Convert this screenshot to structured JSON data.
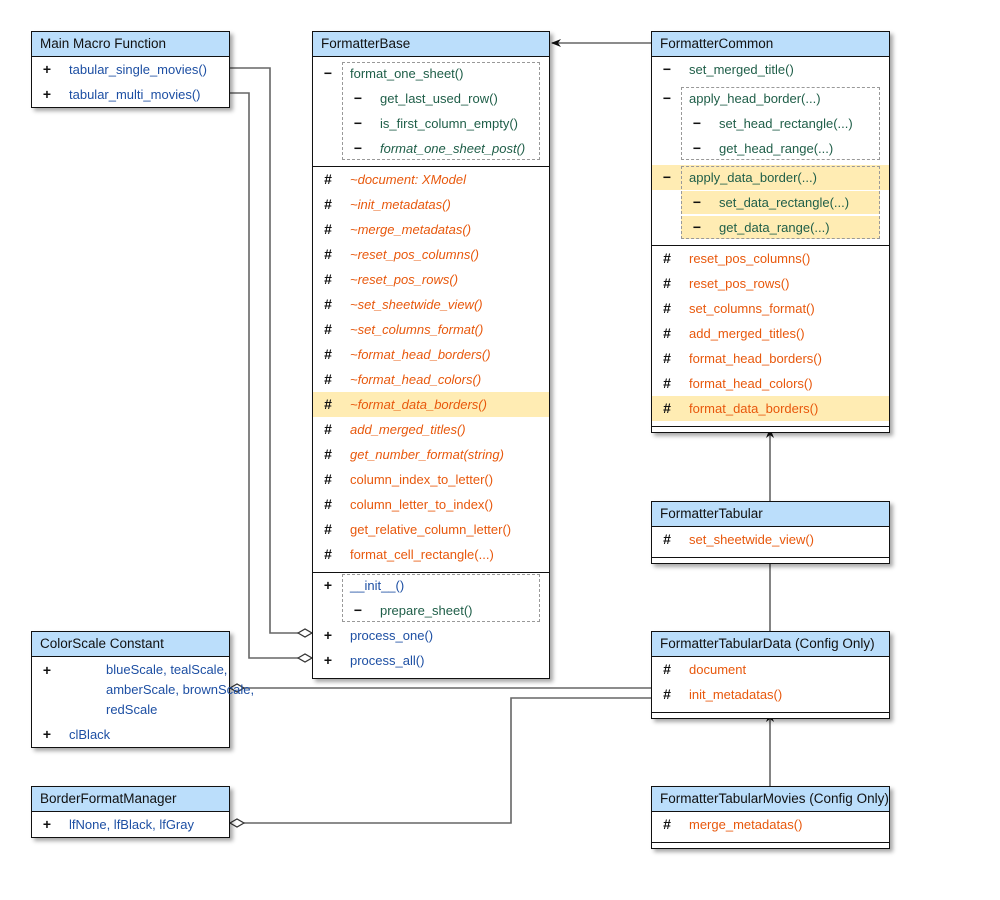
{
  "classes": [
    {
      "id": "main",
      "title": "Main Macro Function",
      "sections": [
        [
          {
            "visibility": "+",
            "text": "tabular_single_movies()",
            "kind": "pub"
          },
          {
            "visibility": "+",
            "text": "tabular_multi_movies()",
            "kind": "pub"
          }
        ]
      ]
    },
    {
      "id": "base",
      "title": "FormatterBase",
      "sections": [
        [
          {
            "group": [
              {
                "visibility": "−",
                "text": "format_one_sheet()",
                "kind": "pri"
              },
              {
                "visibility": "−",
                "text": "get_last_used_row()",
                "kind": "pri",
                "nested": true
              },
              {
                "visibility": "−",
                "text": "is_first_column_empty()",
                "kind": "pri",
                "nested": true
              },
              {
                "visibility": "−",
                "text": "format_one_sheet_post()",
                "kind": "pri",
                "nested": true,
                "italic": true
              }
            ]
          }
        ],
        [
          {
            "visibility": "#",
            "text": "~document: XModel",
            "kind": "pro",
            "italic": true
          },
          {
            "visibility": "#",
            "text": "~init_metadatas()",
            "kind": "pro",
            "italic": true
          },
          {
            "visibility": "#",
            "text": "~merge_metadatas()",
            "kind": "pro",
            "italic": true
          },
          {
            "visibility": "#",
            "text": "~reset_pos_columns()",
            "kind": "pro",
            "italic": true
          },
          {
            "visibility": "#",
            "text": "~reset_pos_rows()",
            "kind": "pro",
            "italic": true
          },
          {
            "visibility": "#",
            "text": "~set_sheetwide_view()",
            "kind": "pro",
            "italic": true
          },
          {
            "visibility": "#",
            "text": "~set_columns_format()",
            "kind": "pro",
            "italic": true
          },
          {
            "visibility": "#",
            "text": "~format_head_borders()",
            "kind": "pro",
            "italic": true
          },
          {
            "visibility": "#",
            "text": "~format_head_colors()",
            "kind": "pro",
            "italic": true
          },
          {
            "visibility": "#",
            "text": "~format_data_borders()",
            "kind": "pro",
            "italic": true,
            "highlight": "full"
          },
          {
            "visibility": "#",
            "text": "add_merged_titles()",
            "kind": "pro",
            "italic": true
          },
          {
            "visibility": "#",
            "text": "get_number_format(string)",
            "kind": "pro",
            "italic": true
          },
          {
            "visibility": "#",
            "text": "column_index_to_letter()",
            "kind": "pro"
          },
          {
            "visibility": "#",
            "text": "column_letter_to_index()",
            "kind": "pro"
          },
          {
            "visibility": "#",
            "text": "get_relative_column_letter()",
            "kind": "pro"
          },
          {
            "visibility": "#",
            "text": "format_cell_rectangle(...)",
            "kind": "pro"
          }
        ],
        [
          {
            "group": [
              {
                "visibility": "+",
                "text": "__init__()",
                "kind": "pub"
              },
              {
                "visibility": "−",
                "text": "prepare_sheet()",
                "kind": "pri",
                "nested": true
              }
            ]
          },
          {
            "visibility": "+",
            "text": "process_one()",
            "kind": "pub"
          },
          {
            "visibility": "+",
            "text": "process_all()",
            "kind": "pub"
          }
        ]
      ]
    },
    {
      "id": "common",
      "title": "FormatterCommon",
      "sections": [
        [
          {
            "visibility": "−",
            "text": "set_merged_title()",
            "kind": "pri"
          },
          {
            "group": [
              {
                "visibility": "−",
                "text": "apply_head_border(...)",
                "kind": "pri"
              },
              {
                "visibility": "−",
                "text": "set_head_rectangle(...)",
                "kind": "pri",
                "nested": true
              },
              {
                "visibility": "−",
                "text": "get_head_range(...)",
                "kind": "pri",
                "nested": true
              }
            ]
          },
          {
            "group": [
              {
                "visibility": "−",
                "text": "apply_data_border(...)",
                "kind": "pri",
                "highlight": "full"
              },
              {
                "visibility": "−",
                "text": "set_data_rectangle(...)",
                "kind": "pri",
                "nested": true,
                "highlight": "inner"
              },
              {
                "visibility": "−",
                "text": "get_data_range(...)",
                "kind": "pri",
                "nested": true,
                "highlight": "inner"
              }
            ]
          }
        ],
        [
          {
            "visibility": "#",
            "text": "reset_pos_columns()",
            "kind": "pro"
          },
          {
            "visibility": "#",
            "text": "reset_pos_rows()",
            "kind": "pro"
          },
          {
            "visibility": "#",
            "text": "set_columns_format()",
            "kind": "pro"
          },
          {
            "visibility": "#",
            "text": "add_merged_titles()",
            "kind": "pro"
          },
          {
            "visibility": "#",
            "text": "format_head_borders()",
            "kind": "pro"
          },
          {
            "visibility": "#",
            "text": "format_head_colors()",
            "kind": "pro"
          },
          {
            "visibility": "#",
            "text": "format_data_borders()",
            "kind": "pro",
            "highlight": "full"
          }
        ],
        []
      ]
    },
    {
      "id": "tabular",
      "title": "FormatterTabular",
      "sections": [
        [
          {
            "visibility": "#",
            "text": "set_sheetwide_view()",
            "kind": "pro"
          }
        ],
        []
      ]
    },
    {
      "id": "tabdata",
      "title": "FormatterTabularData (Config Only)",
      "sections": [
        [
          {
            "visibility": "#",
            "text": "document",
            "kind": "pro"
          },
          {
            "visibility": "#",
            "text": "init_metadatas()",
            "kind": "pro"
          }
        ],
        []
      ]
    },
    {
      "id": "movies",
      "title": "FormatterTabularMovies (Config Only)",
      "sections": [
        [
          {
            "visibility": "#",
            "text": "merge_metadatas()",
            "kind": "pro"
          }
        ],
        []
      ]
    },
    {
      "id": "color",
      "title": "ColorScale Constant",
      "sections": [
        [
          {
            "visibility": "+",
            "text": "blueScale, tealScale,\namberScale, brownScale,\nredScale",
            "kind": "pub",
            "multi": true
          },
          {
            "visibility": "+",
            "text": "clBlack",
            "kind": "pub"
          }
        ]
      ]
    },
    {
      "id": "border",
      "title": "BorderFormatManager",
      "sections": [
        [
          {
            "visibility": "+",
            "text": "lfNone, lfBlack, lfGray",
            "kind": "pub"
          }
        ]
      ]
    }
  ],
  "relations": [
    {
      "type": "inheritance",
      "from": "FormatterCommon",
      "to": "FormatterBase"
    },
    {
      "type": "inheritance",
      "from": "FormatterTabular",
      "to": "FormatterCommon"
    },
    {
      "type": "inheritance",
      "from": "FormatterTabularData (Config Only)",
      "to": "FormatterTabular"
    },
    {
      "type": "inheritance",
      "from": "FormatterTabularMovies (Config Only)",
      "to": "FormatterTabularData (Config Only)"
    },
    {
      "type": "aggregation",
      "from": "tabular_single_movies()",
      "to": "process_one()"
    },
    {
      "type": "aggregation",
      "from": "tabular_multi_movies()",
      "to": "process_all()"
    },
    {
      "type": "aggregation",
      "from": "FormatterTabularData (Config Only)",
      "to": "ColorScale Constant"
    },
    {
      "type": "aggregation",
      "from": "FormatterTabularData (Config Only)",
      "to": "BorderFormatManager"
    }
  ],
  "colors": {
    "header": "#bbdefb",
    "highlight": "#ffecb3",
    "public": "#1d4fa3",
    "protected": "#e8580c",
    "private": "#1f5e48"
  }
}
